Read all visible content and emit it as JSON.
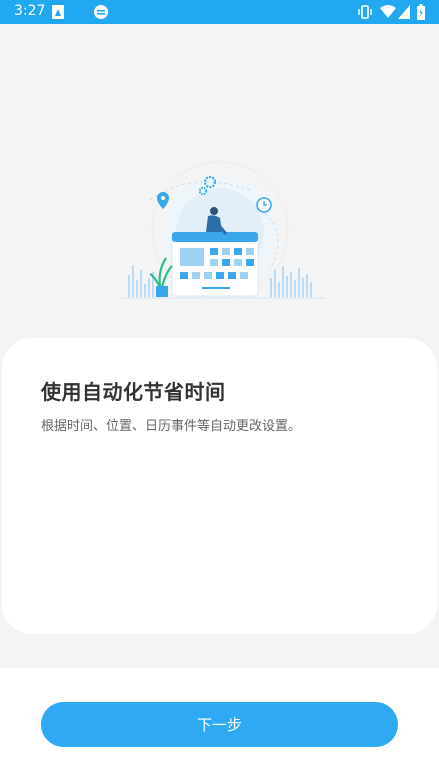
{
  "status_bar": {
    "time": "3:27",
    "background": "#21a8f0"
  },
  "onboarding": {
    "title": "使用自动化节省时间",
    "subtitle": "根据时间、位置、日历事件等自动更改设置。"
  },
  "actions": {
    "next_label": "下一步",
    "accent": "#2fa9f3"
  }
}
